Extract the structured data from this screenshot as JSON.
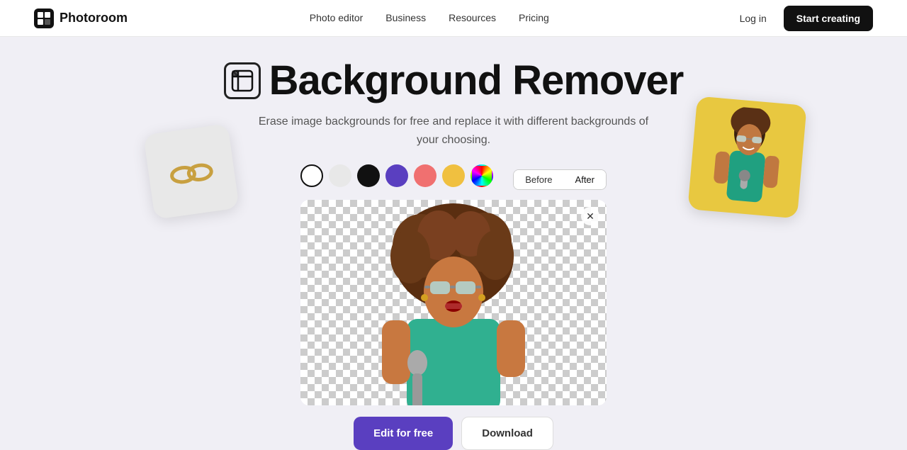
{
  "nav": {
    "logo_text": "Photoroom",
    "links": [
      {
        "label": "Photo editor",
        "href": "#"
      },
      {
        "label": "Business",
        "href": "#"
      },
      {
        "label": "Resources",
        "href": "#"
      },
      {
        "label": "Pricing",
        "href": "#"
      }
    ],
    "login_label": "Log in",
    "start_label": "Start creating"
  },
  "hero": {
    "title": "Background Remover",
    "subtitle_line1": "Erase image backgrounds for free and replace it with different backgrounds of",
    "subtitle_line2": "your choosing.",
    "icon_aria": "background-remover-icon"
  },
  "swatches": [
    {
      "id": "white",
      "label": "White"
    },
    {
      "id": "light-gray",
      "label": "Light gray"
    },
    {
      "id": "black",
      "label": "Black"
    },
    {
      "id": "purple",
      "label": "Purple"
    },
    {
      "id": "pink",
      "label": "Pink"
    },
    {
      "id": "yellow",
      "label": "Yellow"
    },
    {
      "id": "rainbow",
      "label": "Rainbow"
    }
  ],
  "preview": {
    "before_label": "Before",
    "after_label": "After",
    "active_tab": "After",
    "close_aria": "close-preview"
  },
  "actions": {
    "edit_label": "Edit for free",
    "download_label": "Download"
  }
}
